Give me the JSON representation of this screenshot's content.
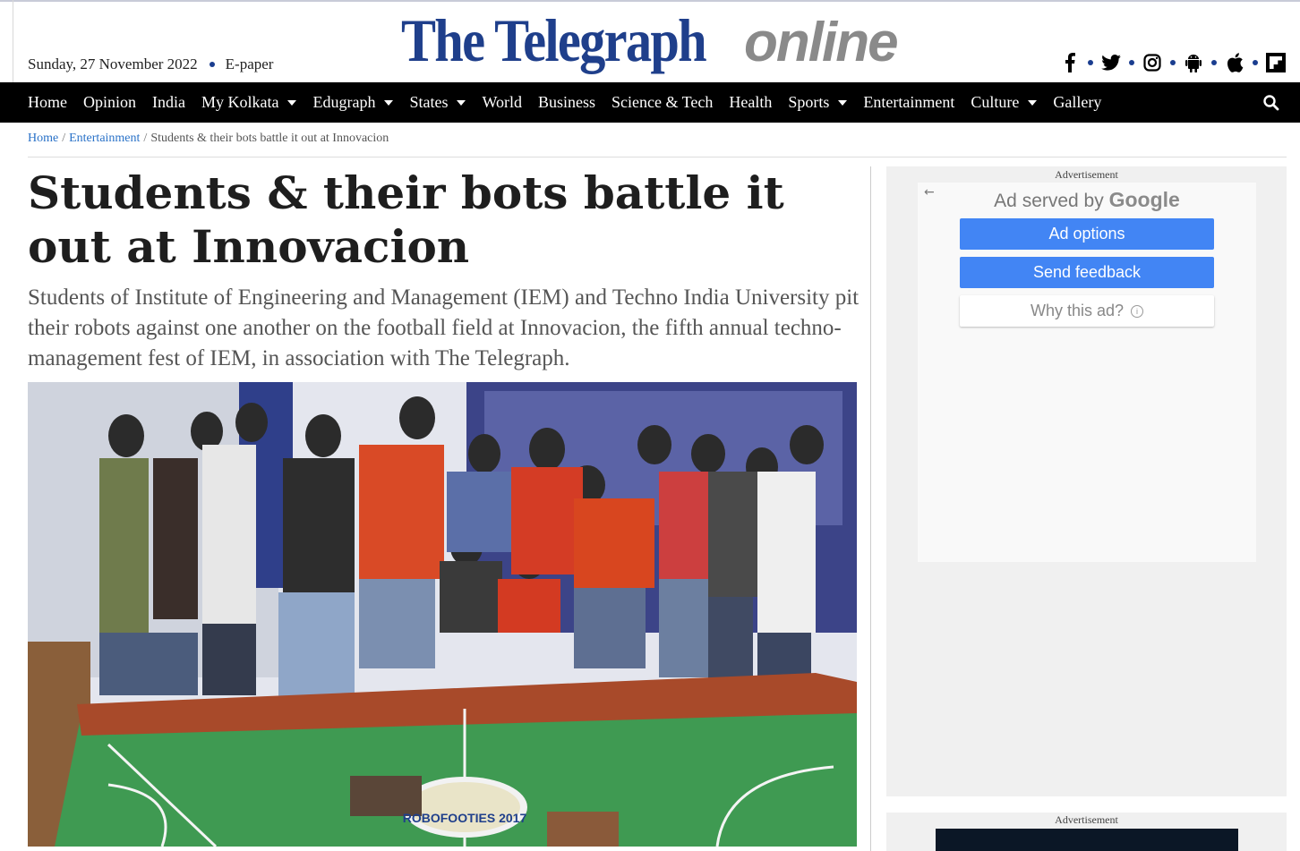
{
  "header": {
    "date": "Sunday, 27 November 2022",
    "epaper_label": "E-paper",
    "logo_primary": "The Telegraph",
    "logo_secondary": "online",
    "social_icons": [
      "facebook-icon",
      "twitter-icon",
      "instagram-icon",
      "android-icon",
      "apple-icon",
      "flipboard-icon"
    ]
  },
  "nav": {
    "items": [
      {
        "label": "Home",
        "dropdown": false
      },
      {
        "label": "Opinion",
        "dropdown": false
      },
      {
        "label": "India",
        "dropdown": false
      },
      {
        "label": "My Kolkata",
        "dropdown": true
      },
      {
        "label": "Edugraph",
        "dropdown": true
      },
      {
        "label": "States",
        "dropdown": true
      },
      {
        "label": "World",
        "dropdown": false
      },
      {
        "label": "Business",
        "dropdown": false
      },
      {
        "label": "Science & Tech",
        "dropdown": false
      },
      {
        "label": "Health",
        "dropdown": false
      },
      {
        "label": "Sports",
        "dropdown": true
      },
      {
        "label": "Entertainment",
        "dropdown": false
      },
      {
        "label": "Culture",
        "dropdown": true
      },
      {
        "label": "Gallery",
        "dropdown": false
      }
    ],
    "search_icon": "search-icon"
  },
  "breadcrumb": {
    "home": "Home",
    "section": "Entertainment",
    "current": "Students & their bots battle it out at Innovacion",
    "separator": "/"
  },
  "article": {
    "headline": "Students & their bots battle it out at Innovacion",
    "standfirst": "Students of Institute of Engineering and Management (IEM) and Techno India University pit their robots against one another on the football field at Innovacion, the fifth annual techno-management fest of IEM, in association with The Telegraph.",
    "photo_text": "ROBOFOOTIES 2017"
  },
  "ads": {
    "label": "Advertisement",
    "served_by": "Ad served by",
    "google": "Google",
    "ad_options": "Ad options",
    "send_feedback": "Send feedback",
    "why_this_ad": "Why this ad?",
    "second_label": "Advertisement"
  },
  "colors": {
    "logo_blue": "#1f3f8b",
    "nav_bg": "#000000",
    "link_blue": "#2a72c8",
    "ad_button_blue": "#4285f4"
  }
}
